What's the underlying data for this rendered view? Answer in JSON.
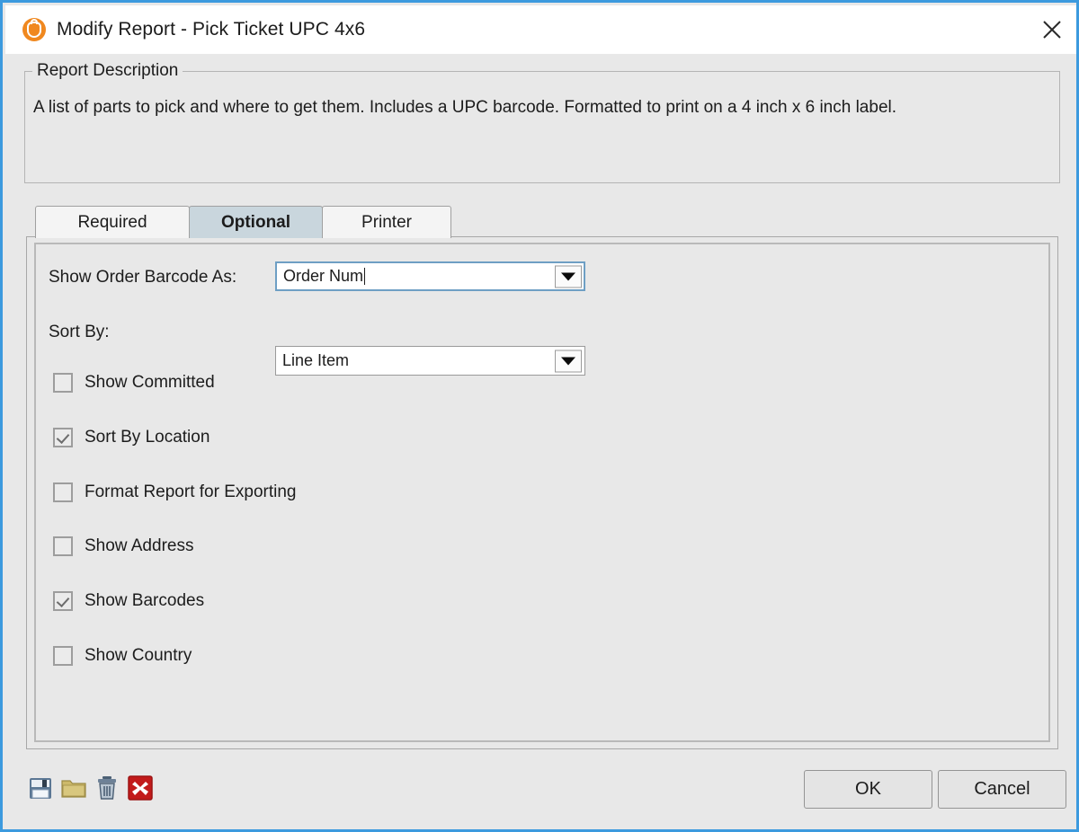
{
  "window": {
    "title": "Modify Report - Pick Ticket UPC 4x6",
    "app_icon": "report-app-icon",
    "close_icon": "close-icon"
  },
  "description": {
    "legend": "Report Description",
    "text": "A list of parts to pick and where to get them. Includes a UPC barcode. Formatted to print on a 4 inch x 6 inch label."
  },
  "tabs": [
    {
      "label": "Required",
      "selected": false
    },
    {
      "label": "Optional",
      "selected": true
    },
    {
      "label": "Printer",
      "selected": false
    }
  ],
  "fields": [
    {
      "label": "Show Order Barcode As:",
      "value": "Order Num",
      "focused": true,
      "arrow_icon": "chevron-down-icon"
    },
    {
      "label": "Sort By:",
      "value": "Line Item",
      "focused": false,
      "arrow_icon": "chevron-down-icon"
    }
  ],
  "checkboxes": [
    {
      "label": "Show Committed",
      "checked": false
    },
    {
      "label": "Sort By Location",
      "checked": true
    },
    {
      "label": "Format Report for Exporting",
      "checked": false
    },
    {
      "label": "Show Address",
      "checked": false
    },
    {
      "label": "Show Barcodes",
      "checked": true
    },
    {
      "label": "Show Country",
      "checked": false
    }
  ],
  "toolbar": [
    {
      "name": "save-icon",
      "title": "Save"
    },
    {
      "name": "folder-icon",
      "title": "Open"
    },
    {
      "name": "trash-icon",
      "title": "Delete"
    },
    {
      "name": "delete-x-icon",
      "title": "Remove"
    }
  ],
  "buttons": {
    "ok": "OK",
    "cancel": "Cancel"
  },
  "colors": {
    "window_border": "#3c9ade",
    "dialog_bg": "#e8e8e8",
    "tab_selected": "#c9d6dd",
    "accent_orange": "#f0881f",
    "delete_red": "#c21a1a"
  }
}
